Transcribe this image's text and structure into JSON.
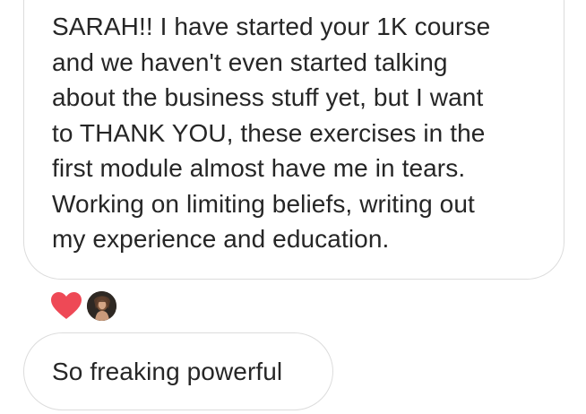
{
  "messages": [
    {
      "lines": [
        "SARAH!! I have started your 1K course",
        "and we haven't even started talking",
        "about the business stuff yet, but I want",
        "to THANK YOU, these exercises in the",
        "first module almost have me in tears.",
        "Working on limiting beliefs, writing out",
        "my experience and education."
      ]
    },
    {
      "text": "So freaking powerful"
    }
  ],
  "reactions": {
    "icon": "heart-icon",
    "heart_color": "#ee4956"
  },
  "colors": {
    "bubble_border": "#dcdcdc",
    "text": "#262626",
    "background": "#ffffff"
  }
}
